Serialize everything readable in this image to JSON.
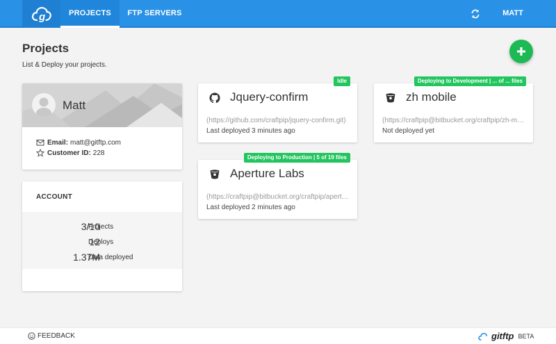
{
  "topbar": {
    "nav": [
      {
        "label": "PROJECTS",
        "active": true
      },
      {
        "label": "FTP SERVERS",
        "active": false
      }
    ],
    "user": "MATT",
    "accent": "#2a92e6"
  },
  "header": {
    "title": "Projects",
    "subtitle": "List & Deploy your projects."
  },
  "profile": {
    "name": "Matt",
    "email_label": "Email:",
    "email": "matt@gitftp.com",
    "customer_id_label": "Customer ID:",
    "customer_id": "228"
  },
  "account": {
    "title": "ACCOUNT",
    "stats": [
      {
        "value": "3/10",
        "label": "Projects"
      },
      {
        "value": "12",
        "label": "Deploys"
      },
      {
        "value": "1.37M",
        "label": "Data deployed"
      }
    ]
  },
  "projects": [
    {
      "title": "Jquery-confirm",
      "icon": "github-icon",
      "url": "(https://github.com/craftpip/jquery-confirm.git)",
      "status": "Last deployed 3 minutes ago",
      "badge": "Idle"
    },
    {
      "title": "zh mobile",
      "icon": "bitbucket-icon",
      "url": "(https://craftpip@bitbucket.org/craftpip/zh-mobile.git)",
      "status": "Not deployed yet",
      "badge": "Deploying to Development | ... of ... files"
    },
    {
      "title": "Aperture Labs",
      "icon": "bitbucket-icon",
      "url": "(https://craftpip@bitbucket.org/craftpip/aperture-labs.git)",
      "status": "Last deployed 2 minutes ago",
      "badge": "Deploying to Production | 5 of 19 files"
    }
  ],
  "footer": {
    "feedback": "FEEDBACK",
    "brand": "gitftp",
    "tag": "BETA"
  },
  "colors": {
    "badge": "#22c55e",
    "fab": "#1db954"
  }
}
